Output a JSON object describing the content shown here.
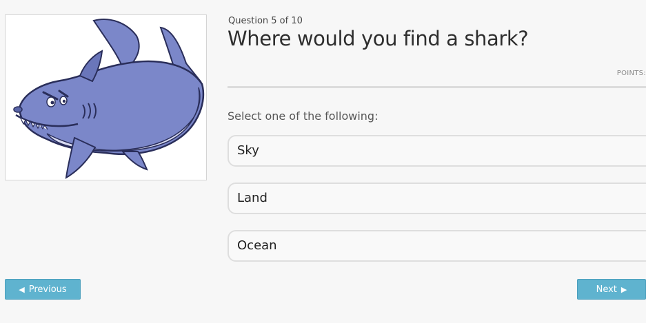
{
  "quiz": {
    "progress_label": "Question 5 of 10",
    "question": "Where would you find a shark?",
    "points_label": "POINTS:",
    "instruction": "Select one of the following:",
    "options": [
      {
        "label": "Sky"
      },
      {
        "label": "Land"
      },
      {
        "label": "Ocean"
      }
    ]
  },
  "image": {
    "subject": "cartoon-shark",
    "colors": {
      "body": "#7b87c9",
      "belly": "#d9dcf2",
      "outline": "#2a2e5a"
    }
  },
  "nav": {
    "previous_label": "Previous",
    "previous_icon": "caret-left-icon",
    "next_label": "Next",
    "next_icon": "caret-right-icon"
  },
  "colors": {
    "button": "#5fb3cf",
    "background": "#f7f7f7",
    "divider": "#dcdcdc"
  }
}
